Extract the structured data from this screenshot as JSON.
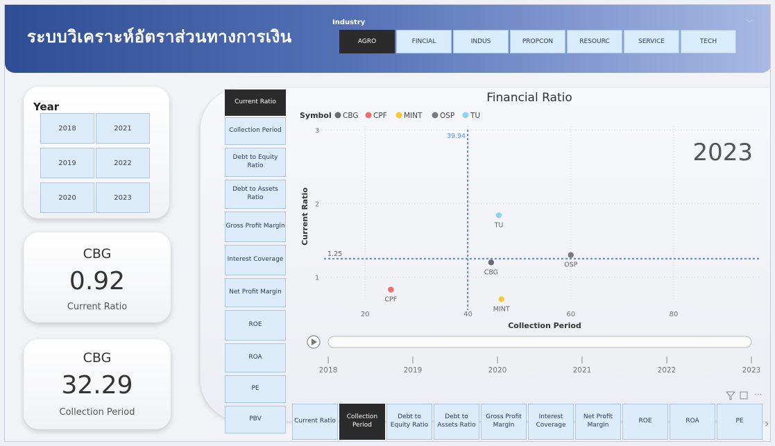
{
  "header": {
    "title": "ระบบวิเคราะห์อัตราส่วนทางการเงิน",
    "industry_label": "Industry",
    "industries": [
      {
        "label": "AGRO",
        "active": true
      },
      {
        "label": "FINCIAL",
        "active": false
      },
      {
        "label": "INDUS",
        "active": false
      },
      {
        "label": "PROPCON",
        "active": false
      },
      {
        "label": "RESOURC",
        "active": false
      },
      {
        "label": "SERVICE",
        "active": false
      },
      {
        "label": "TECH",
        "active": false
      }
    ]
  },
  "year_slicer": {
    "title": "Year",
    "years": [
      "2018",
      "2021",
      "2019",
      "2022",
      "2020",
      "2023"
    ]
  },
  "kpi_cards": [
    {
      "symbol": "CBG",
      "value": "0.92",
      "label": "Current Ratio"
    },
    {
      "symbol": "CBG",
      "value": "32.29",
      "label": "Collection Period"
    }
  ],
  "y_metric_buttons": [
    "Current Ratio",
    "Collection Period",
    "Debt to Equity Ratio",
    "Debt to Assets Ratio",
    "Gross Profit Margin",
    "Interest Coverage",
    "Net Profit Margin",
    "ROE",
    "ROA",
    "PE",
    "PBV"
  ],
  "x_metric_buttons": [
    "Current Ratio",
    "Collection Period",
    "Debt to Equity Ratio",
    "Debt to Assets Ratio",
    "Gross Profit Margin",
    "Interest Coverage",
    "Net Profit Margin",
    "ROE",
    "ROA",
    "PE"
  ],
  "active_y_metric": "Current Ratio",
  "active_x_metric": "Collection Period",
  "play_axis": {
    "years": [
      "2018",
      "2019",
      "2020",
      "2021",
      "2022",
      "2023"
    ],
    "current": "2023"
  },
  "chart_data": {
    "type": "scatter",
    "title": "Financial Ratio",
    "legend_title": "Symbol",
    "xlabel": "Collection Period",
    "ylabel": "Current Ratio",
    "xlim": [
      12,
      97
    ],
    "ylim": [
      0.6,
      3.05
    ],
    "x_ticks": [
      20,
      40,
      60,
      80
    ],
    "y_ticks": [
      1,
      2,
      3
    ],
    "year_watermark": "2023",
    "ref_lines": {
      "x": 39.94,
      "y": 1.25,
      "x_label": "39.94",
      "y_label": "1.25",
      "color": "#5b8ff9"
    },
    "series": [
      {
        "name": "CBG",
        "color": "#676b73",
        "x": 44.5,
        "y": 1.2
      },
      {
        "name": "CPF",
        "color": "#f36d6d",
        "x": 25,
        "y": 0.83
      },
      {
        "name": "MINT",
        "color": "#f6cb3b",
        "x": 46.5,
        "y": 0.7
      },
      {
        "name": "OSP",
        "color": "#767a82",
        "x": 60,
        "y": 1.3
      },
      {
        "name": "TU",
        "color": "#8fd3ee",
        "x": 46,
        "y": 1.84
      }
    ]
  }
}
